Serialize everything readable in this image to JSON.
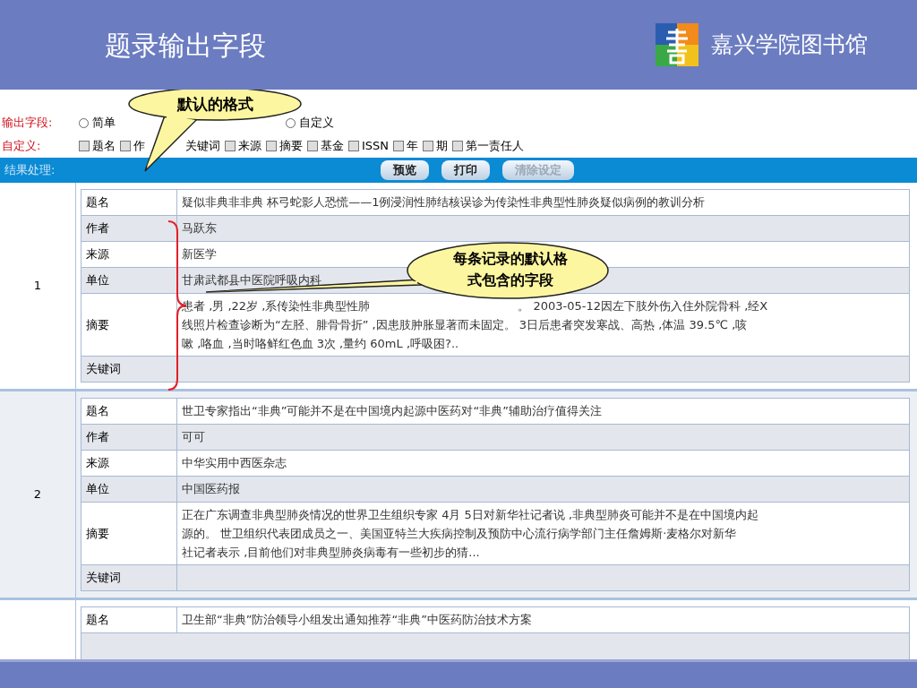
{
  "slide": {
    "title": "题录输出字段",
    "library": "嘉兴学院图书馆"
  },
  "output_fields": {
    "label": "输出字段:",
    "options": [
      {
        "label": "简单",
        "selected": false
      },
      {
        "label": "自定义",
        "selected": false
      }
    ]
  },
  "custom": {
    "label": "自定义:",
    "fields": [
      {
        "label": "题名",
        "checked": false
      },
      {
        "label": "作",
        "checked": false
      },
      {
        "kind": "label",
        "label": "关键词"
      },
      {
        "label": "来源",
        "checked": false
      },
      {
        "label": "摘要",
        "checked": false
      },
      {
        "label": "基金",
        "checked": false
      },
      {
        "label": "ISSN",
        "checked": false
      },
      {
        "label": "年",
        "checked": false
      },
      {
        "label": "期",
        "checked": false
      },
      {
        "label": "第一责任人",
        "checked": false
      }
    ]
  },
  "toolbar": {
    "label": "结果处理:",
    "buttons": [
      {
        "label": "预览",
        "disabled": false
      },
      {
        "label": "打印",
        "disabled": false
      },
      {
        "label": "清除设定",
        "disabled": true
      }
    ]
  },
  "records": [
    {
      "number": "1",
      "fields": [
        {
          "label": "题名",
          "value": "疑似非典非非典 杯弓蛇影人恐慌——1例浸润性肺结核误诊为传染性非典型性肺炎疑似病例的教训分析"
        },
        {
          "label": "作者",
          "value": "马跃东"
        },
        {
          "label": "来源",
          "value": "新医学"
        },
        {
          "label": "单位",
          "value": "甘肃武都县中医院呼吸内科"
        },
        {
          "label": "摘要",
          "lines": [
            [
              "患者 ,男 ,22岁 ,系传染性非典型性肺",
              "。 2003-05-12因左下肢外伤入住外院骨科 ,经X"
            ],
            [
              "线照片检查诊断为“左胫、腓骨骨折” ,因患肢肿胀显著而未固定。 3日后患者突发寒战、高热 ,体温 39.5℃ ,咳"
            ],
            [
              "嗽 ,咯血 ,当时咯鲜红色血 3次 ,量约 60mL ,呼吸困?.."
            ]
          ]
        },
        {
          "label": "关键词"
        }
      ]
    },
    {
      "number": "2",
      "fields": [
        {
          "label": "题名",
          "value": "世卫专家指出“非典”可能并不是在中国境内起源中医药对“非典”辅助治疗值得关注"
        },
        {
          "label": "作者",
          "value": "可可"
        },
        {
          "label": "来源",
          "value": "中华实用中西医杂志"
        },
        {
          "label": "单位",
          "value": "中国医药报"
        },
        {
          "label": "摘要",
          "lines": [
            [
              "正在广东调查非典型肺炎情况的世界卫生组织专家 4月 5日对新华社记者说 ,非典型肺炎可能并不是在中国境内起"
            ],
            [
              "源的。      世卫组织代表团成员之一、美国亚特兰大疾病控制及预防中心流行病学部门主任詹姆斯·麦格尔对新华"
            ],
            [
              "社记者表示 ,目前他们对非典型肺炎病毒有一些初步的猜..."
            ]
          ]
        },
        {
          "label": "关键词"
        }
      ]
    },
    {
      "fields": [
        {
          "label": "题名",
          "value": "卫生部“非典”防治领导小组发出通知推荐“非典”中医药防治技术方案"
        }
      ]
    }
  ],
  "callouts": [
    {
      "lines": [
        "默认的格式"
      ]
    },
    {
      "lines": [
        "每条记录的默认格",
        "式包含的字段"
      ]
    }
  ]
}
